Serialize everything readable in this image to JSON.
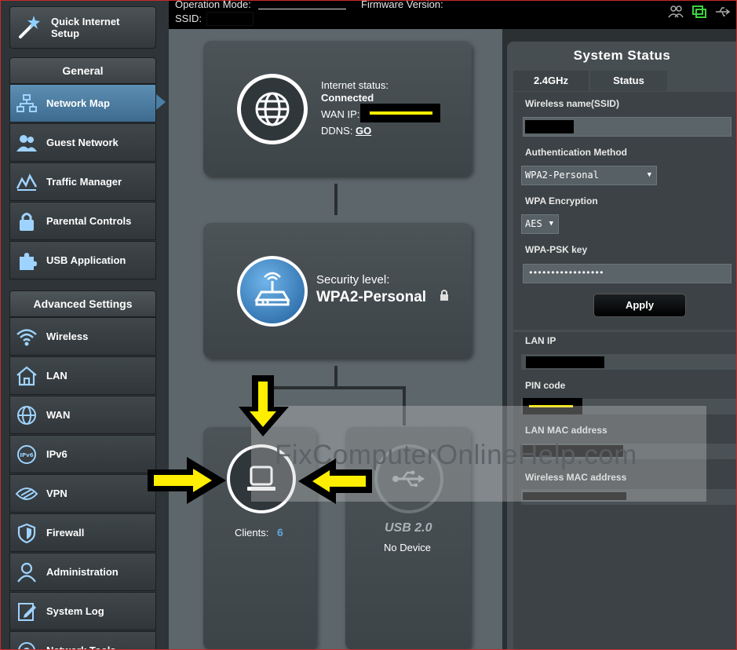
{
  "topbar": {
    "operation_mode_label": "Operation Mode:",
    "firmware_label": "Firmware Version:",
    "ssid_label": "SSID:",
    "icons": [
      "clients-icon",
      "network-status-icon",
      "usb-icon"
    ]
  },
  "sidebar": {
    "quick_setup": "Quick Internet Setup",
    "general_header": "General",
    "general_items": [
      {
        "label": "Network Map",
        "icon": "network-map-icon",
        "active": true
      },
      {
        "label": "Guest Network",
        "icon": "guest-network-icon"
      },
      {
        "label": "Traffic Manager",
        "icon": "traffic-manager-icon"
      },
      {
        "label": "Parental Controls",
        "icon": "parental-controls-icon"
      },
      {
        "label": "USB Application",
        "icon": "usb-application-icon"
      }
    ],
    "advanced_header": "Advanced Settings",
    "advanced_items": [
      {
        "label": "Wireless",
        "icon": "wireless-icon"
      },
      {
        "label": "LAN",
        "icon": "lan-icon"
      },
      {
        "label": "WAN",
        "icon": "wan-icon"
      },
      {
        "label": "IPv6",
        "icon": "ipv6-icon"
      },
      {
        "label": "VPN",
        "icon": "vpn-icon"
      },
      {
        "label": "Firewall",
        "icon": "firewall-icon"
      },
      {
        "label": "Administration",
        "icon": "administration-icon"
      },
      {
        "label": "System Log",
        "icon": "system-log-icon"
      },
      {
        "label": "Network Tools",
        "icon": "network-tools-icon"
      }
    ]
  },
  "map": {
    "internet": {
      "status_label": "Internet status:",
      "status_value": "Connected",
      "wan_ip_label": "WAN IP:",
      "ddns_label": "DDNS:",
      "ddns_link": "GO"
    },
    "router": {
      "security_label": "Security level:",
      "security_value": "WPA2-Personal"
    },
    "clients": {
      "label": "Clients:",
      "count": "6"
    },
    "usb": {
      "type": "USB 2.0",
      "status": "No Device"
    }
  },
  "status_panel": {
    "title": "System Status",
    "tabs": [
      "2.4GHz",
      "Status"
    ],
    "wireless_name_label": "Wireless name(SSID)",
    "auth_method_label": "Authentication Method",
    "auth_method_value": "WPA2-Personal",
    "wpa_encryption_label": "WPA Encryption",
    "wpa_encryption_value": "AES",
    "psk_label": "WPA-PSK key",
    "psk_value": "•••••••••••••••••",
    "apply_label": "Apply",
    "lan_ip_label": "LAN IP",
    "pin_code_label": "PIN code",
    "lan_mac_label": "LAN MAC address",
    "wireless_mac_label": "Wireless MAC address"
  },
  "watermark": "FixComputerOnlineHelp.com",
  "colors": {
    "accent_yellow": "#ffee00",
    "active_nav": "#4a7fa5",
    "link_blue": "#5fa8d8"
  }
}
